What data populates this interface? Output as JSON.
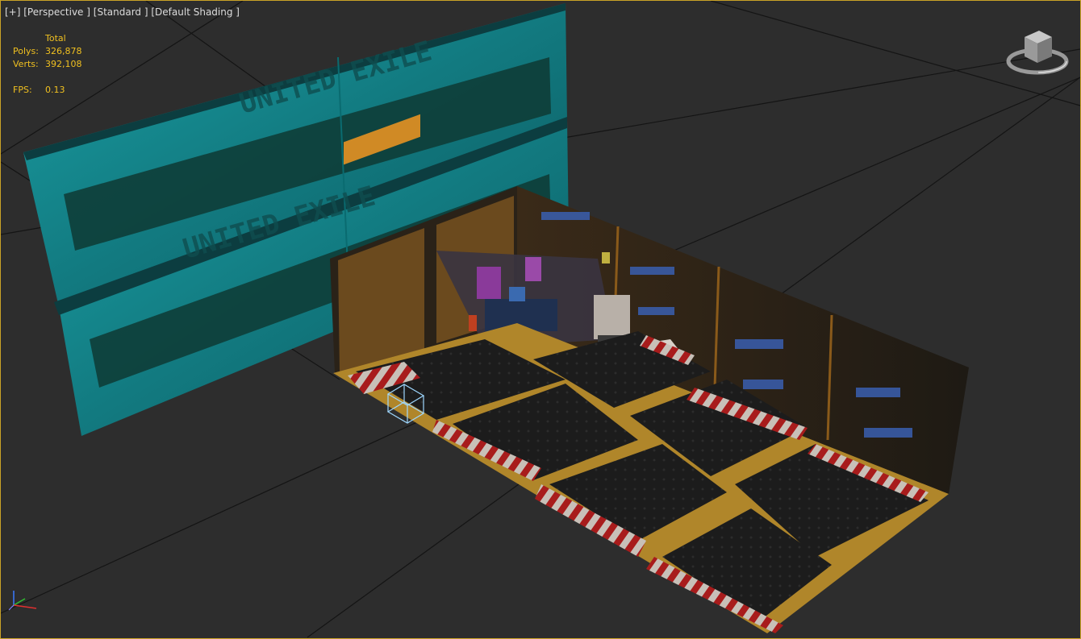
{
  "viewport": {
    "menu_plus": "[+]",
    "view": "[Perspective ]",
    "style": "[Standard ]",
    "shading": "[Default Shading ]"
  },
  "stats": {
    "total_label": "Total",
    "polys_label": "Polys:",
    "polys_value": "326,878",
    "verts_label": "Verts:",
    "verts_value": "392,108",
    "fps_label": "FPS:",
    "fps_value": "0.13"
  },
  "billboard": {
    "text_upper": "UNITED EXILE",
    "text_lower": "UNITED EXILE"
  },
  "colors": {
    "border": "#c9a227",
    "stats": "#f0c020",
    "background": "#2d2d2d",
    "grid": "#111111",
    "billboard": "#1a8a8f",
    "floor_frame": "#b0862a",
    "hazard_red": "#b02020"
  },
  "icons": {
    "viewcube": "viewcube-icon",
    "axis_gizmo": "axis-gizmo-icon"
  }
}
